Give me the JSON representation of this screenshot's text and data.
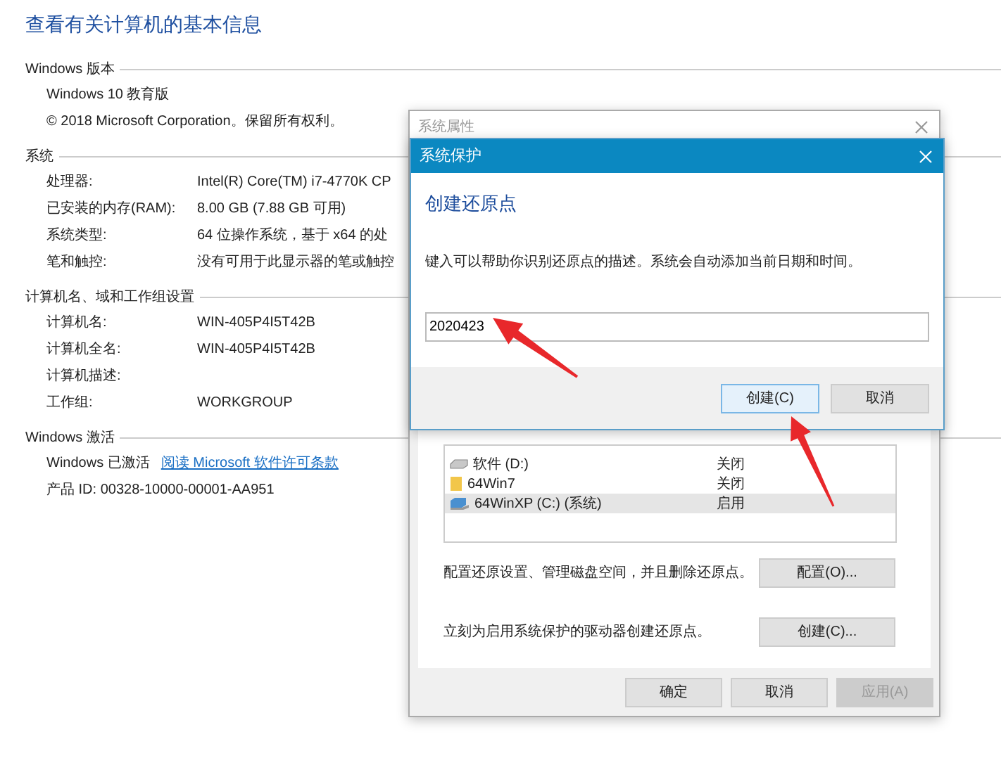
{
  "page": {
    "title": "查看有关计算机的基本信息",
    "sections": [
      {
        "heading": "Windows 版本",
        "rows": [
          {
            "kind": "text",
            "text": "Windows 10 教育版"
          },
          {
            "kind": "text",
            "text": "© 2018 Microsoft Corporation。保留所有权利。"
          }
        ]
      },
      {
        "heading": "系统",
        "rows": [
          {
            "kind": "pair",
            "label": "处理器:",
            "value": "Intel(R) Core(TM) i7-4770K CP"
          },
          {
            "kind": "pair",
            "label": "已安装的内存(RAM):",
            "value": "8.00 GB (7.88 GB 可用)"
          },
          {
            "kind": "pair",
            "label": "系统类型:",
            "value": "64 位操作系统，基于 x64 的处"
          },
          {
            "kind": "pair",
            "label": "笔和触控:",
            "value": "没有可用于此显示器的笔或触控"
          }
        ]
      },
      {
        "heading": "计算机名、域和工作组设置",
        "rows": [
          {
            "kind": "pair",
            "label": "计算机名:",
            "value": "WIN-405P4I5T42B"
          },
          {
            "kind": "pair",
            "label": "计算机全名:",
            "value": "WIN-405P4I5T42B"
          },
          {
            "kind": "pair",
            "label": "计算机描述:",
            "value": ""
          },
          {
            "kind": "pair",
            "label": "工作组:",
            "value": "WORKGROUP"
          }
        ]
      },
      {
        "heading": "Windows 激活",
        "rows": [
          {
            "kind": "link",
            "text": "Windows 已激活",
            "link": "阅读 Microsoft 软件许可条款"
          },
          {
            "kind": "text",
            "text": "产品 ID: 00328-10000-00001-AA951"
          }
        ]
      }
    ]
  },
  "system_properties": {
    "title": "系统属性",
    "drives": [
      {
        "kind": "drive",
        "name": "软件 (D:)",
        "protection": "关闭",
        "selected": false
      },
      {
        "kind": "folder",
        "name": "64Win7",
        "protection": "关闭",
        "selected": false
      },
      {
        "kind": "system",
        "name": "64WinXP  (C:) (系统)",
        "protection": "启用",
        "selected": true
      }
    ],
    "actions": [
      {
        "description": "配置还原设置、管理磁盘空间，并且删除还原点。",
        "button": "配置(O)..."
      },
      {
        "description": "立刻为启用系统保护的驱动器创建还原点。",
        "button": "创建(C)..."
      }
    ],
    "buttons": [
      {
        "label": "确定",
        "disabled": false
      },
      {
        "label": "取消",
        "disabled": false
      },
      {
        "label": "应用(A)",
        "disabled": true
      }
    ]
  },
  "system_protection": {
    "title": "系统保护",
    "heading": "创建还原点",
    "description": "键入可以帮助你识别还原点的描述。系统会自动添加当前日期和时间。",
    "input": {
      "value": "2020423"
    },
    "buttons": [
      {
        "label": "创建(C)",
        "focused": true
      },
      {
        "label": "取消",
        "focused": false
      }
    ]
  }
}
